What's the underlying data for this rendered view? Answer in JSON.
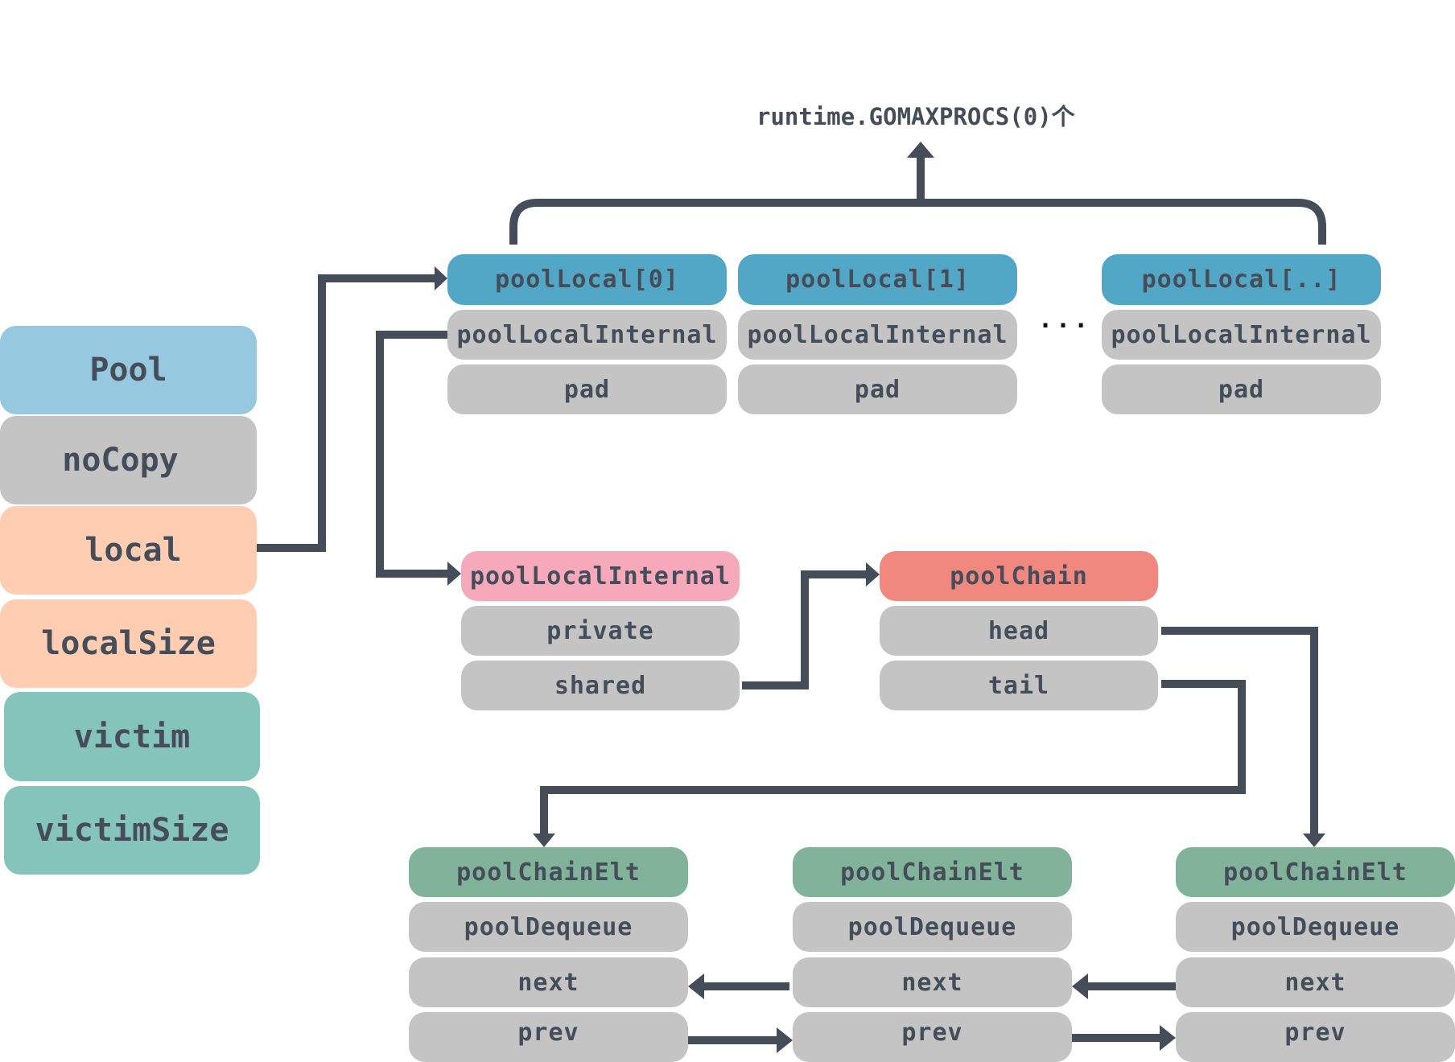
{
  "pool_struct": {
    "fields": [
      "Pool",
      "noCopy",
      "local",
      "localSize",
      "victim",
      "victimSize"
    ]
  },
  "gomaxprocs_label": "runtime.GOMAXPROCS(0)个",
  "ellipsis": "...",
  "pool_locals": [
    {
      "title": "poolLocal[0]",
      "fields": [
        "poolLocalInternal",
        "pad"
      ]
    },
    {
      "title": "poolLocal[1]",
      "fields": [
        "poolLocalInternal",
        "pad"
      ]
    },
    {
      "title": "poolLocal[..]",
      "fields": [
        "poolLocalInternal",
        "pad"
      ]
    }
  ],
  "pool_local_internal": {
    "title": "poolLocalInternal",
    "fields": [
      "private",
      "shared"
    ]
  },
  "pool_chain": {
    "title": "poolChain",
    "fields": [
      "head",
      "tail"
    ]
  },
  "pool_chain_elts": [
    {
      "title": "poolChainElt",
      "fields": [
        "poolDequeue",
        "next",
        "prev"
      ]
    },
    {
      "title": "poolChainElt",
      "fields": [
        "poolDequeue",
        "next",
        "prev"
      ]
    },
    {
      "title": "poolChainElt",
      "fields": [
        "poolDequeue",
        "next",
        "prev"
      ]
    }
  ],
  "colors": {
    "wire": "#454d59",
    "pool": "#96c8e0",
    "field_gray": "#c4c4c4",
    "local": "#fecdb2",
    "victim": "#84c4bb",
    "pool_local": "#52a7c7",
    "pool_local_internal": "#f5a9bb",
    "pool_chain": "#f08880",
    "pool_chain_elt": "#80b39a"
  }
}
